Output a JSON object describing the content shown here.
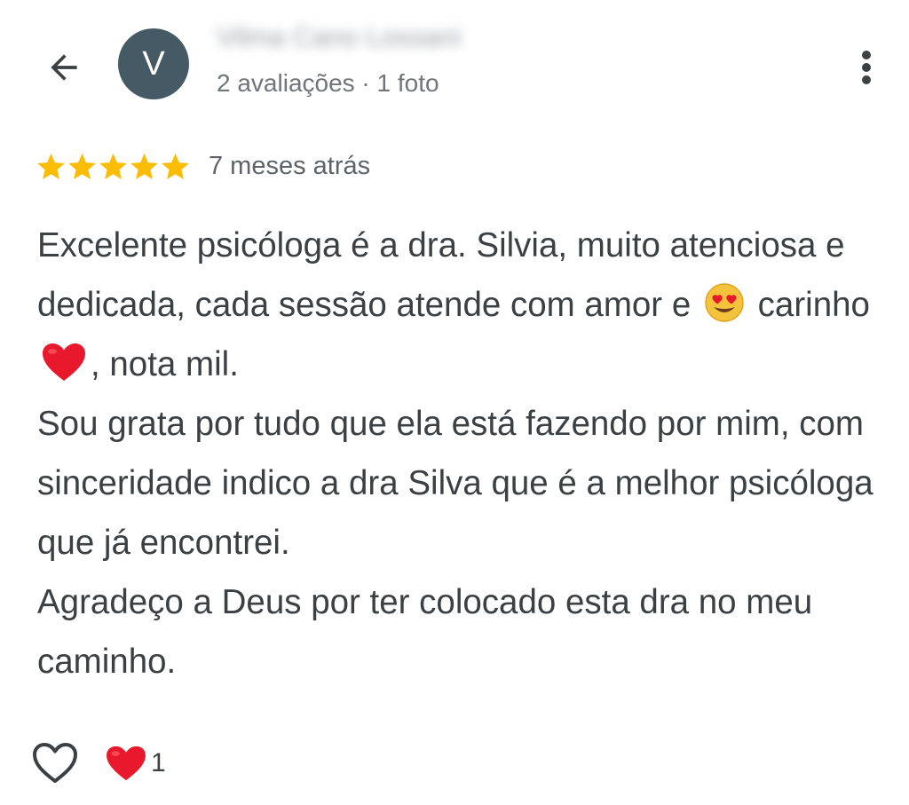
{
  "header": {
    "reviewer_initial": "V",
    "reviewer_name": "Vilma Cano Lossani",
    "reviewer_meta": "2 avaliações · 1 foto"
  },
  "review": {
    "rating": 5,
    "rating_max": 5,
    "date": "7 meses atrás",
    "p1_a": "Excelente psicóloga é a dra. Silvia, muito atenciosa e dedicada, cada sessão atende com amor e",
    "p1_b": "carinho",
    "p1_c": ", nota mil.",
    "p2": "Sou grata por tudo que ela está fazendo por mim, com sinceridade indico a dra Silva que é a melhor psicóloga que já encontrei.",
    "p3": "Agradeço a Deus por ter colocado esta dra no meu caminho."
  },
  "footer": {
    "reaction_count": "1"
  },
  "colors": {
    "star": "#fbbc04",
    "avatar_bg": "#455a64",
    "heart": "#e8192c",
    "icon": "#3c4043"
  },
  "icons": [
    "back-arrow-icon",
    "more-vert-icon",
    "star-icon",
    "heart-eyes-emoji",
    "red-heart-emoji",
    "heart-outline-icon"
  ]
}
